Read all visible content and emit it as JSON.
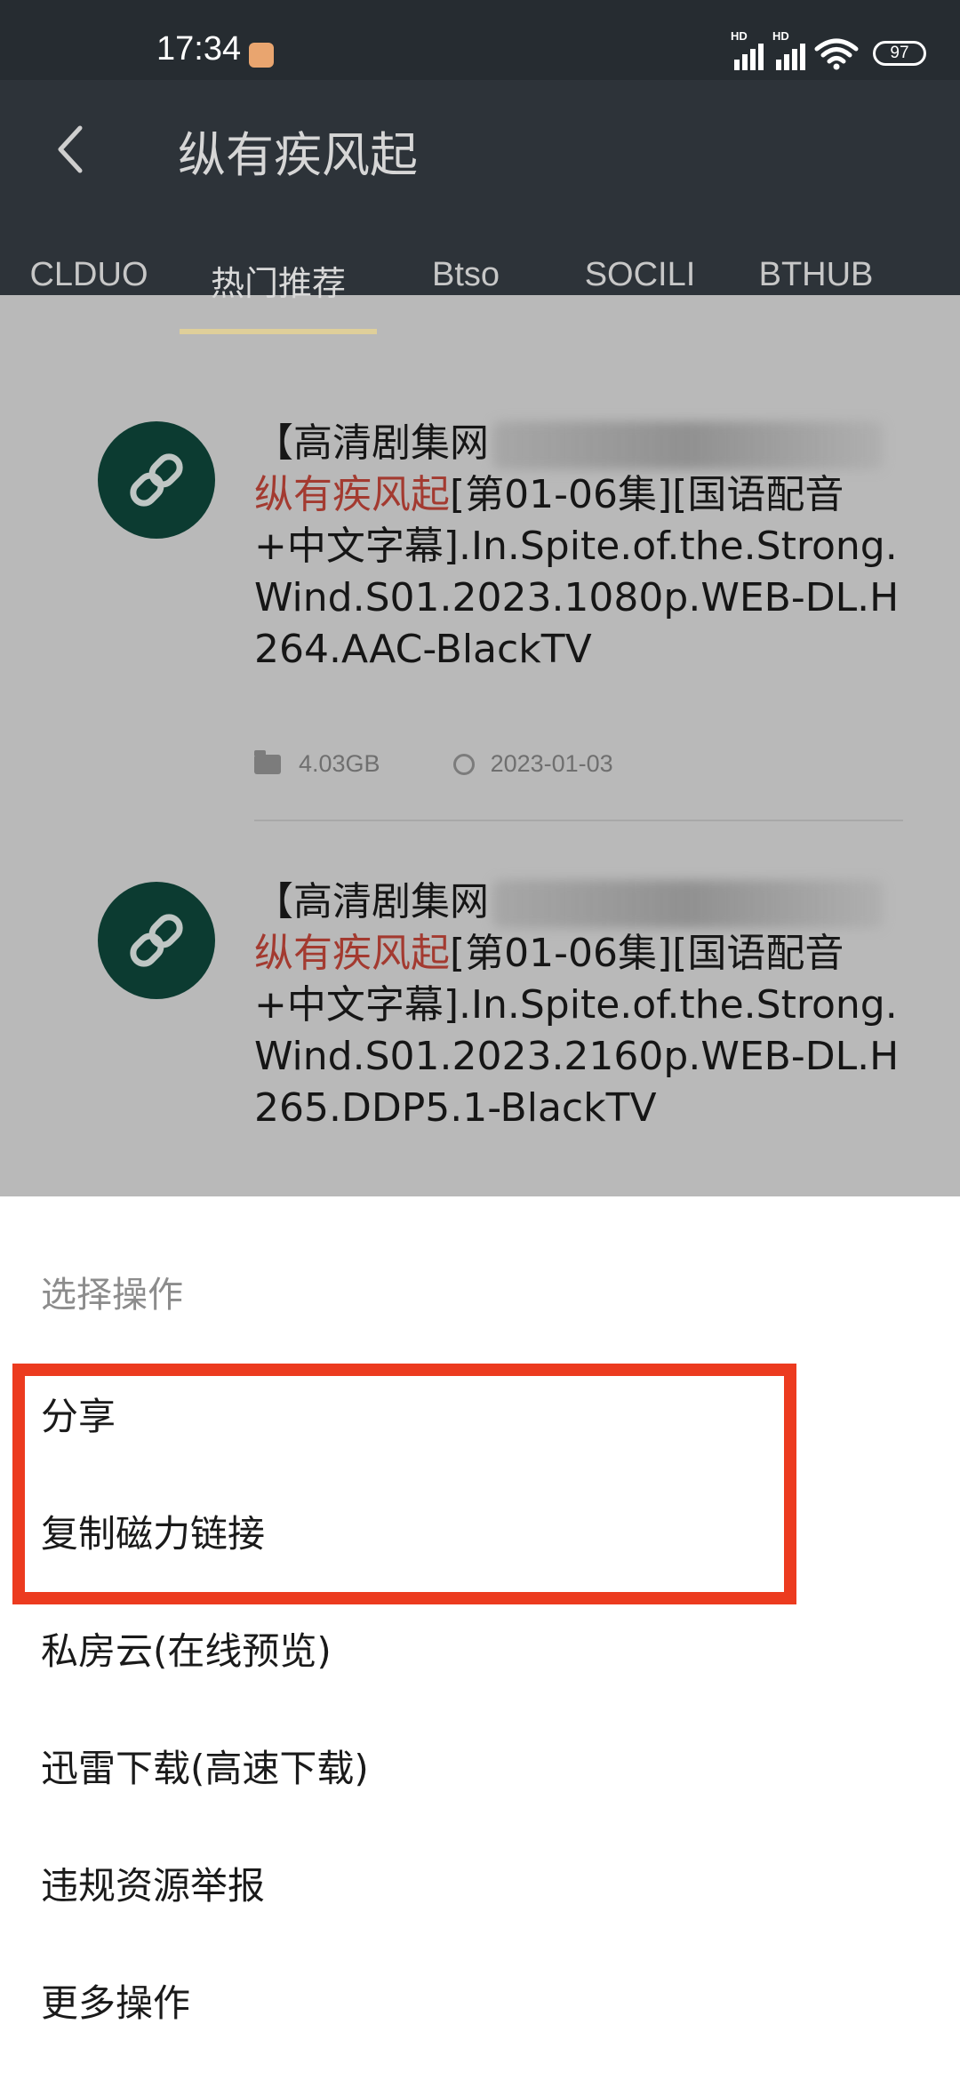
{
  "status_bar": {
    "time": "17:34",
    "battery": "97",
    "signal_label": "HD",
    "icons": [
      "notification-app-icon",
      "signal-icon",
      "signal-icon",
      "wifi-icon",
      "battery-icon"
    ]
  },
  "app_bar": {
    "title": "纵有疾风起",
    "back_icon": "back-arrow-icon"
  },
  "tabs": [
    {
      "label": "CLDUO",
      "active": false
    },
    {
      "label": "热门推荐",
      "active": true
    },
    {
      "label": "Btso",
      "active": false
    },
    {
      "label": "SOCILI",
      "active": false
    },
    {
      "label": "BTHUB",
      "active": false
    }
  ],
  "results": [
    {
      "title_prefix": "【高清剧集网",
      "title_highlight": "纵有疾风起",
      "title_rest": "[第01-06集][国语配音+中文字幕].In.Spite.of.the.Strong.Wind.S01.2023.1080p.WEB-DL.H264.AAC-BlackTV",
      "size": "4.03GB",
      "date": "2023-01-03",
      "icon": "link-icon"
    },
    {
      "title_prefix": "【高清剧集网",
      "title_highlight": "纵有疾风起",
      "title_rest": "[第01-06集][国语配音+中文字幕].In.Spite.of.the.Strong.Wind.S01.2023.2160p.WEB-DL.H265.DDP5.1-BlackTV",
      "icon": "link-icon"
    }
  ],
  "sheet": {
    "title": "选择操作",
    "items": [
      "分享",
      "复制磁力链接",
      "私房云(在线预览)",
      "迅雷下载(高速下载)",
      "违规资源举报",
      "更多操作"
    ]
  },
  "colors": {
    "app_bar": "#2d3339",
    "tab_indicator": "#dfcf9a",
    "highlight_text": "#a33a30",
    "annotation_box": "#ec3b1f",
    "avatar": "#0c3b31"
  }
}
